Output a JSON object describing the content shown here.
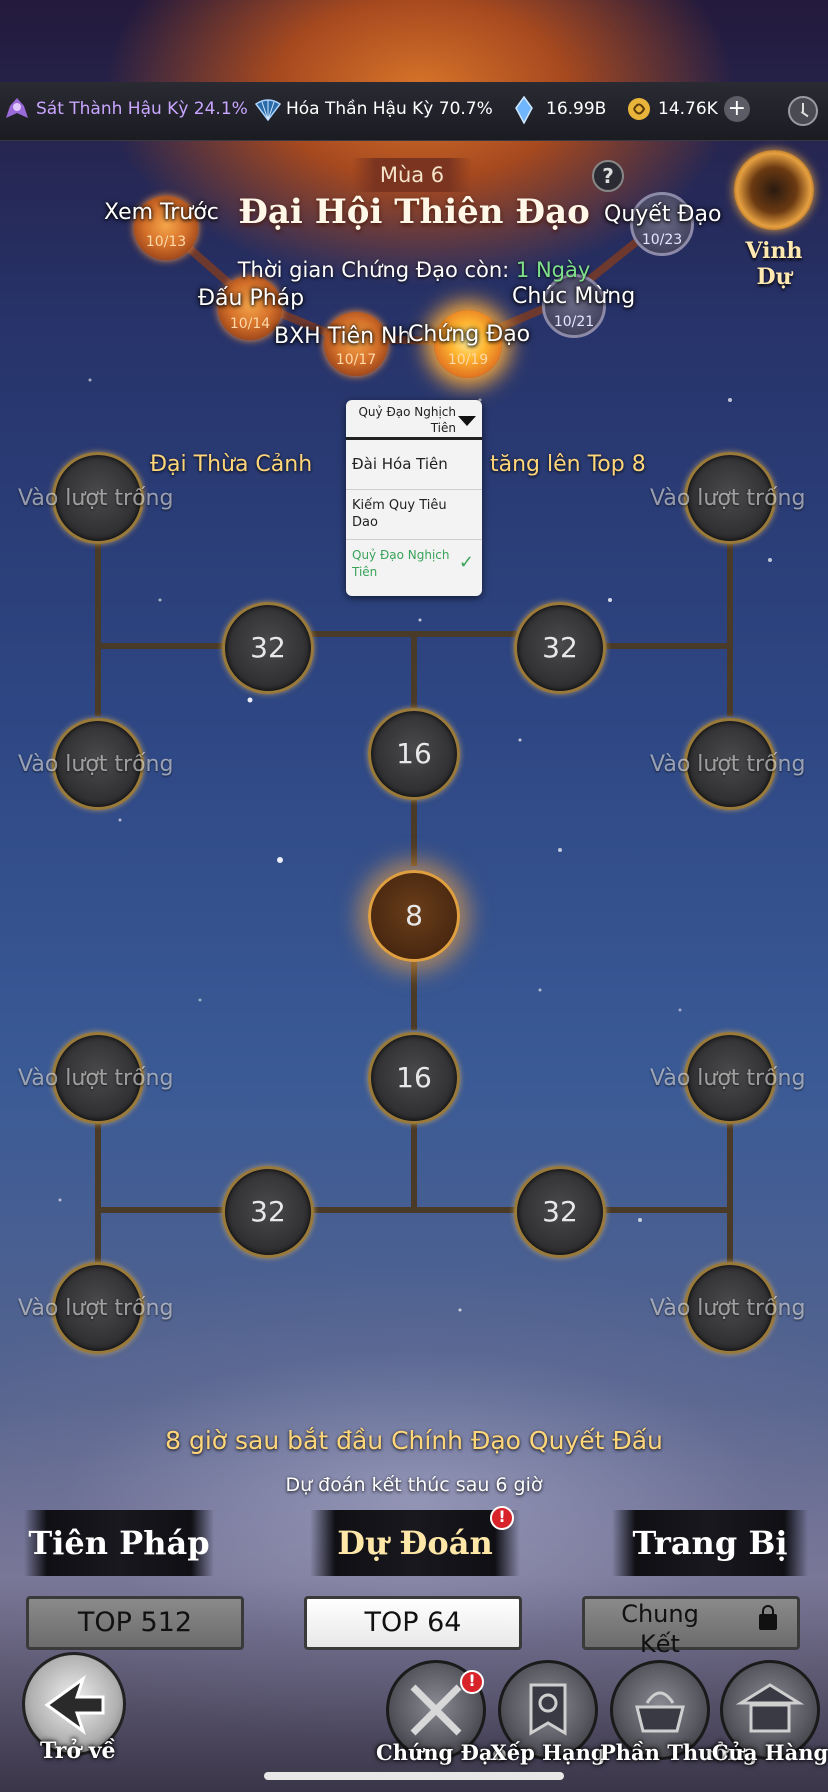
{
  "statusbar": {
    "realm1": "Sát Thành Hậu Kỳ 24.1%",
    "realm2": "Hóa Thần Hậu Kỳ 70.7%",
    "currency1": "16.99B",
    "currency2": "14.76K",
    "plus": "+",
    "realm1_color": "#c9a6ff"
  },
  "header": {
    "season": "Mùa 6",
    "title": "Đại Hội Thiên Đạo",
    "help": "?",
    "honor": "Vinh Dự",
    "countdown_prefix": "Thời gian Chứng Đạo còn: ",
    "countdown_value": "1 Ngày"
  },
  "stages": [
    {
      "label": "Xem Trước",
      "date": "10/13"
    },
    {
      "label": "Đấu Pháp",
      "date": "10/14"
    },
    {
      "label": "BXH Tiên Nh",
      "date": "10/17"
    },
    {
      "label": "Chứng Đạo",
      "date": "10/19"
    },
    {
      "label": "Chúc Mừng",
      "date": "10/21"
    },
    {
      "label": "Quyết Đạo",
      "date": "10/23"
    }
  ],
  "dropdown": {
    "selected": "Quỷ Đạo Nghịch Tiên",
    "options": [
      "Đài Hóa Tiên",
      "Kiếm Quy Tiêu Dao",
      "Quỷ Đạo Nghịch Tiên"
    ]
  },
  "notice": {
    "left": "Đại Thừa Cảnh",
    "right": "tăng lên Top 8"
  },
  "bracket": {
    "empty": "Vào lượt trống",
    "r32": "32",
    "r16": "16",
    "r8": "8"
  },
  "info": {
    "line1": "8 giờ sau bắt đầu Chính Đạo Quyết Đấu",
    "line2": "Dự đoán kết thúc sau 6 giờ"
  },
  "tabs": [
    "Tiên Pháp",
    "Dự Đoán",
    "Trang Bị"
  ],
  "stage_buttons": [
    "TOP 512",
    "TOP 64",
    "Chung Kết"
  ],
  "nav": {
    "back": "Trở về",
    "items": [
      "Chứng Đạo",
      "Xếp Hạng",
      "Phần Thưởng",
      "Cửa Hàng"
    ]
  },
  "alert": "!"
}
